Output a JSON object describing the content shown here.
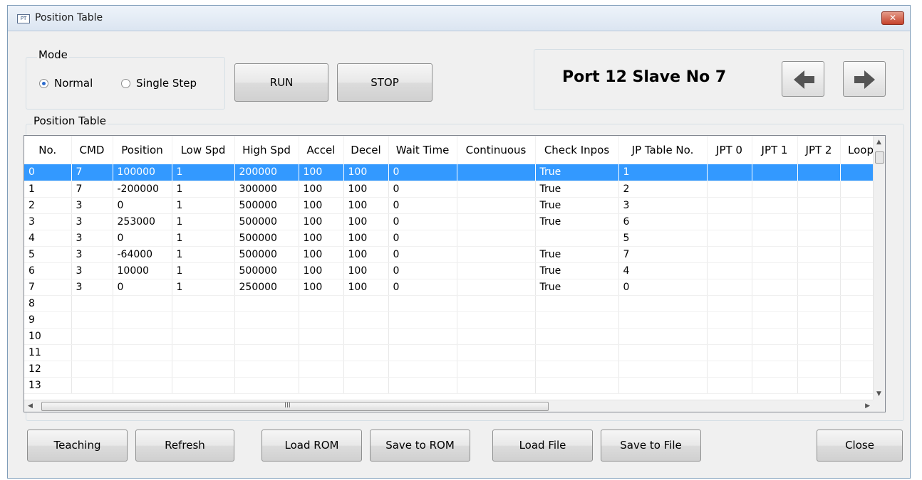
{
  "window": {
    "title": "Position Table",
    "icon_text": "PT",
    "close_label": "✕"
  },
  "mode": {
    "legend": "Mode",
    "options": [
      {
        "label": "Normal",
        "selected": true
      },
      {
        "label": "Single Step",
        "selected": false
      }
    ]
  },
  "controls": {
    "run_label": "RUN",
    "stop_label": "STOP"
  },
  "device": {
    "label": "Port 12 Slave No 7"
  },
  "table": {
    "legend": "Position Table",
    "columns": [
      "No.",
      "CMD",
      "Position",
      "Low Spd",
      "High Spd",
      "Accel",
      "Decel",
      "Wait Time",
      "Continuous",
      "Check Inpos",
      "JP Table No.",
      "JPT 0",
      "JPT 1",
      "JPT 2",
      "Loop"
    ],
    "selected_row": 0,
    "rows": [
      [
        "0",
        "7",
        "100000",
        "1",
        "200000",
        "100",
        "100",
        "0",
        "",
        "True",
        "1",
        "",
        "",
        "",
        ""
      ],
      [
        "1",
        "7",
        "-200000",
        "1",
        "300000",
        "100",
        "100",
        "0",
        "",
        "True",
        "2",
        "",
        "",
        "",
        ""
      ],
      [
        "2",
        "3",
        "0",
        "1",
        "500000",
        "100",
        "100",
        "0",
        "",
        "True",
        "3",
        "",
        "",
        "",
        ""
      ],
      [
        "3",
        "3",
        "253000",
        "1",
        "500000",
        "100",
        "100",
        "0",
        "",
        "True",
        "6",
        "",
        "",
        "",
        ""
      ],
      [
        "4",
        "3",
        "0",
        "1",
        "500000",
        "100",
        "100",
        "0",
        "",
        "",
        "5",
        "",
        "",
        "",
        ""
      ],
      [
        "5",
        "3",
        "-64000",
        "1",
        "500000",
        "100",
        "100",
        "0",
        "",
        "True",
        "7",
        "",
        "",
        "",
        ""
      ],
      [
        "6",
        "3",
        "10000",
        "1",
        "500000",
        "100",
        "100",
        "0",
        "",
        "True",
        "4",
        "",
        "",
        "",
        ""
      ],
      [
        "7",
        "3",
        "0",
        "1",
        "250000",
        "100",
        "100",
        "0",
        "",
        "True",
        "0",
        "",
        "",
        "",
        ""
      ],
      [
        "8",
        "",
        "",
        "",
        "",
        "",
        "",
        "",
        "",
        "",
        "",
        "",
        "",
        "",
        ""
      ],
      [
        "9",
        "",
        "",
        "",
        "",
        "",
        "",
        "",
        "",
        "",
        "",
        "",
        "",
        "",
        ""
      ],
      [
        "10",
        "",
        "",
        "",
        "",
        "",
        "",
        "",
        "",
        "",
        "",
        "",
        "",
        "",
        ""
      ],
      [
        "11",
        "",
        "",
        "",
        "",
        "",
        "",
        "",
        "",
        "",
        "",
        "",
        "",
        "",
        ""
      ],
      [
        "12",
        "",
        "",
        "",
        "",
        "",
        "",
        "",
        "",
        "",
        "",
        "",
        "",
        "",
        ""
      ],
      [
        "13",
        "",
        "",
        "",
        "",
        "",
        "",
        "",
        "",
        "",
        "",
        "",
        "",
        "",
        ""
      ]
    ],
    "hscroll_label": "III"
  },
  "footer": {
    "teaching": "Teaching",
    "refresh": "Refresh",
    "load_rom": "Load ROM",
    "save_rom": "Save to ROM",
    "load_file": "Load File",
    "save_file": "Save to File",
    "close": "Close"
  },
  "colors": {
    "selection": "#3399ff",
    "title_bar": "#dbe5f1",
    "close_button": "#c5432c"
  }
}
